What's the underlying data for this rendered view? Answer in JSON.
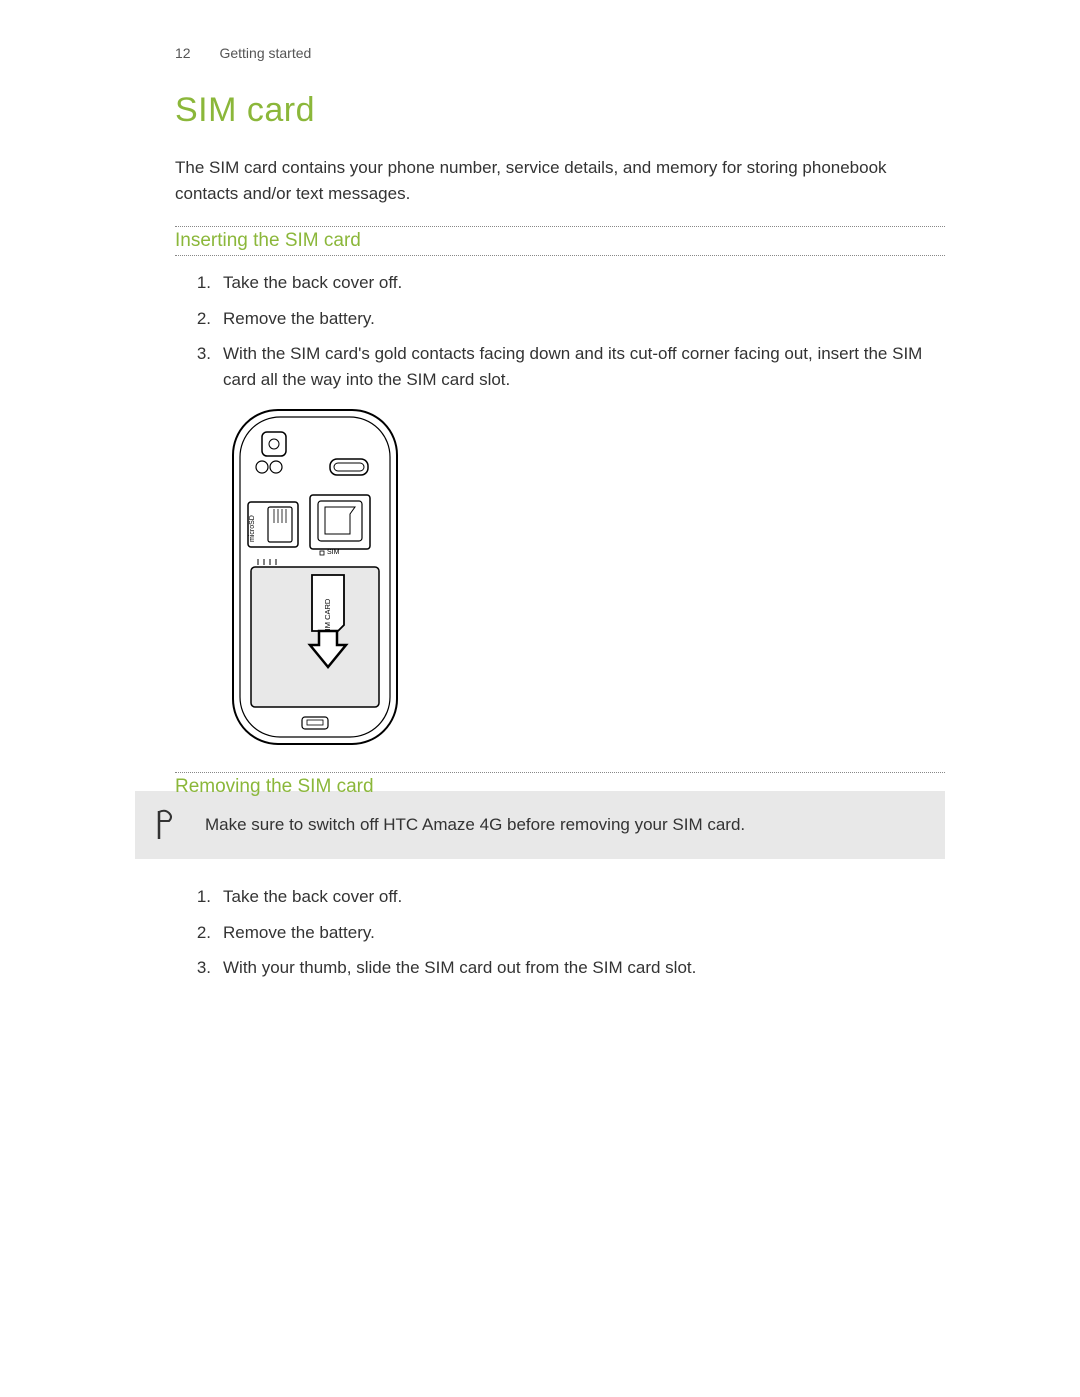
{
  "header": {
    "page_number": "12",
    "section_name": "Getting started"
  },
  "title": "SIM card",
  "intro": "The SIM card contains your phone number, service details, and memory for storing phonebook contacts and/or text messages.",
  "inserting": {
    "heading": "Inserting the SIM card",
    "steps": [
      "Take the back cover off.",
      "Remove the battery.",
      "With the SIM card's gold contacts facing down and its cut-off corner facing out, insert the SIM card all the way into the SIM card slot."
    ],
    "diagram_labels": {
      "sim_card": "SIM CARD",
      "sim_slot": "SIM",
      "microsd": "microSD"
    }
  },
  "removing": {
    "heading": "Removing the SIM card",
    "note": "Make sure to switch off HTC Amaze 4G before removing your SIM card.",
    "steps": [
      "Take the back cover off.",
      "Remove the battery.",
      "With your thumb, slide the SIM card out from the SIM card slot."
    ]
  }
}
